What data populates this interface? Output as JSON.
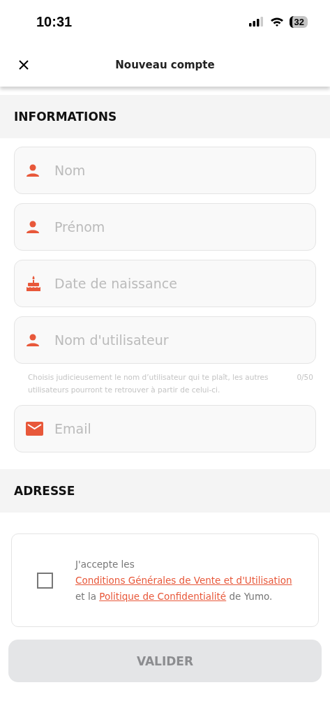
{
  "status_bar": {
    "time": "10:31",
    "battery": "32"
  },
  "header": {
    "title": "Nouveau compte"
  },
  "sections": [
    {
      "title": "INFORMATIONS",
      "fields": [
        {
          "kind": "person",
          "placeholder": "Nom"
        },
        {
          "kind": "person",
          "placeholder": "Prénom"
        },
        {
          "kind": "cake",
          "placeholder": "Date de naissance"
        },
        {
          "kind": "person",
          "placeholder": "Nom d'utilisateur",
          "helper": "Choisis judicieusement le nom d’utilisateur qui te plaît, les autres utilisateurs pourront te retrouver à partir de celui-ci.",
          "counter": "0/50"
        },
        {
          "kind": "mail",
          "placeholder": "Email"
        }
      ]
    },
    {
      "title": "ADRESSE"
    }
  ],
  "terms": {
    "checked": false,
    "text_before": "J'accepte les",
    "link_1": "Conditions Générales de Vente et d'Utilisation",
    "text_middle": "et la",
    "link_2": "Politique de Confidentialité",
    "text_after": "de Yumo."
  },
  "submit": {
    "label": "VALIDER",
    "disabled": true
  }
}
